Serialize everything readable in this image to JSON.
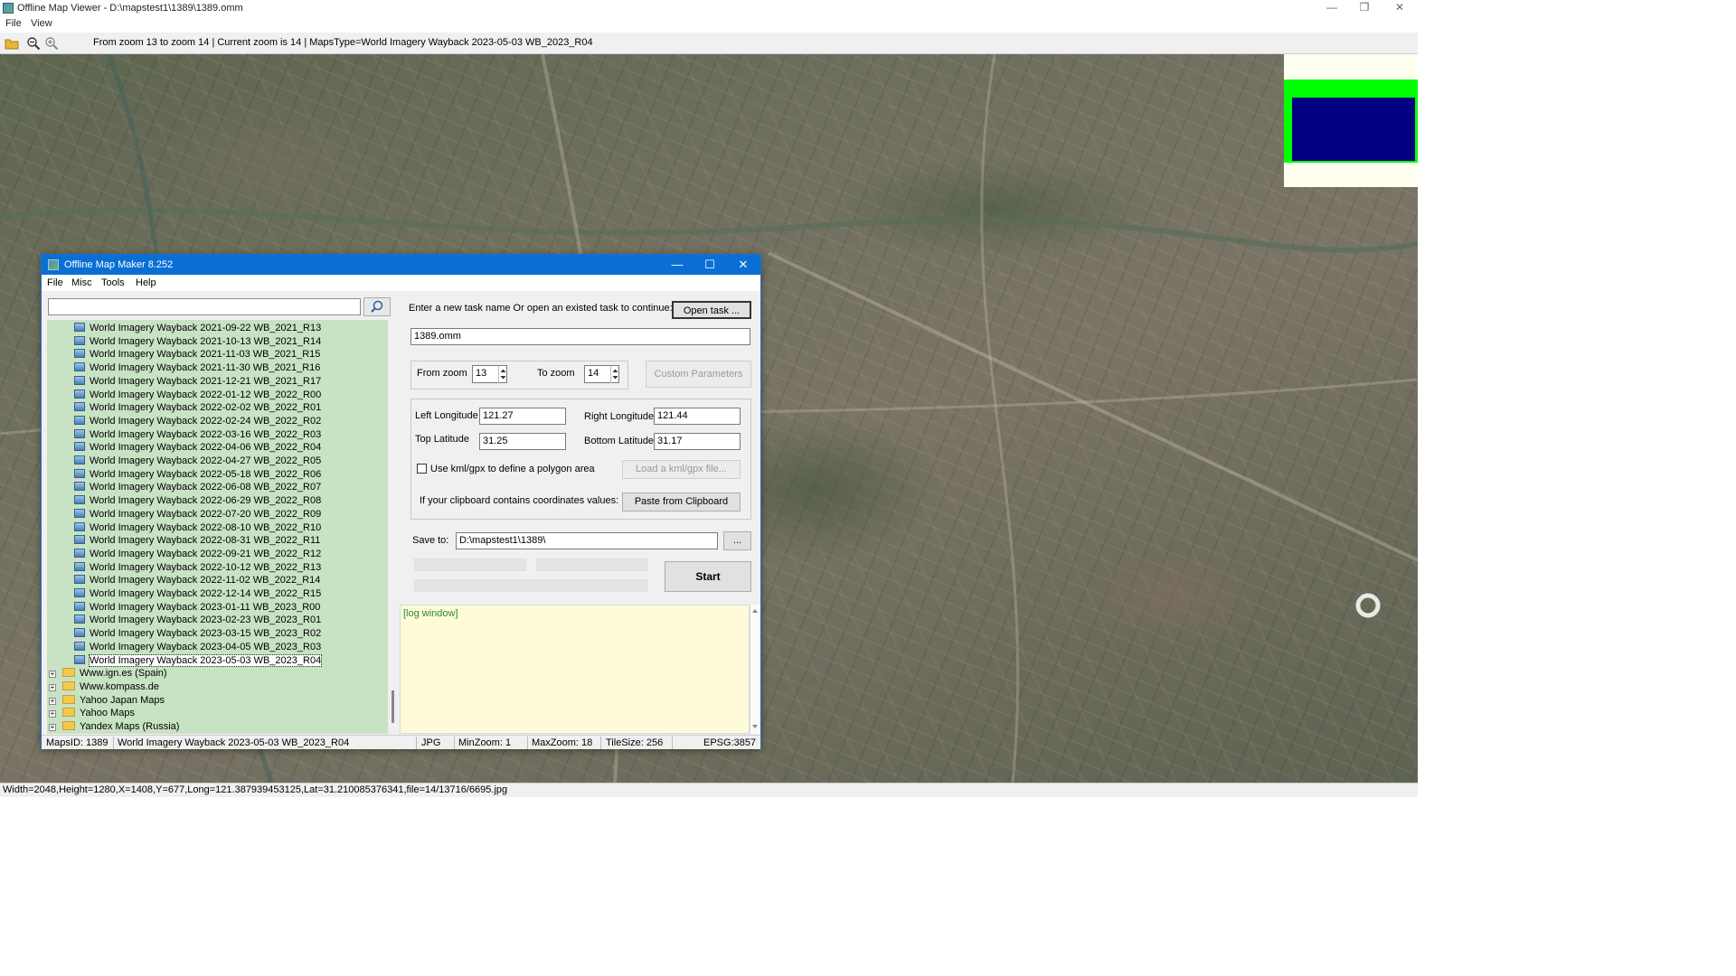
{
  "outer": {
    "title": "Offline Map Viewer - D:\\mapstest1\\1389\\1389.omm",
    "menu": [
      "File",
      "View"
    ],
    "toolbar_status": "From zoom 13 to zoom 14   |   Current zoom is 14  |   MapsType=World Imagery Wayback 2023-05-03 WB_2023_R04",
    "bottom_status": "Width=2048,Height=1280,X=1408,Y=677,Long=121.387939453125,Lat=31.210085376341,file=14/13716/6695.jpg",
    "window_controls": [
      "—",
      "❐",
      "✕"
    ],
    "minimap_colors": {
      "background": "#fffff0",
      "band": "#00ff00",
      "viewport": "#000080"
    }
  },
  "dialog": {
    "title": "Offline Map Maker 8.252",
    "menu": [
      "File",
      "Misc",
      "Tools",
      "Help"
    ],
    "search_value": "",
    "tree_items": [
      "World Imagery Wayback 2021-09-22 WB_2021_R13",
      "World Imagery Wayback 2021-10-13 WB_2021_R14",
      "World Imagery Wayback 2021-11-03 WB_2021_R15",
      "World Imagery Wayback 2021-11-30 WB_2021_R16",
      "World Imagery Wayback 2021-12-21 WB_2021_R17",
      "World Imagery Wayback 2022-01-12 WB_2022_R00",
      "World Imagery Wayback 2022-02-02 WB_2022_R01",
      "World Imagery Wayback 2022-02-24 WB_2022_R02",
      "World Imagery Wayback 2022-03-16 WB_2022_R03",
      "World Imagery Wayback 2022-04-06 WB_2022_R04",
      "World Imagery Wayback 2022-04-27 WB_2022_R05",
      "World Imagery Wayback 2022-05-18 WB_2022_R06",
      "World Imagery Wayback 2022-06-08 WB_2022_R07",
      "World Imagery Wayback 2022-06-29 WB_2022_R08",
      "World Imagery Wayback 2022-07-20 WB_2022_R09",
      "World Imagery Wayback 2022-08-10 WB_2022_R10",
      "World Imagery Wayback 2022-08-31 WB_2022_R11",
      "World Imagery Wayback 2022-09-21 WB_2022_R12",
      "World Imagery Wayback 2022-10-12 WB_2022_R13",
      "World Imagery Wayback 2022-11-02 WB_2022_R14",
      "World Imagery Wayback 2022-12-14 WB_2022_R15",
      "World Imagery Wayback 2023-01-11 WB_2023_R00",
      "World Imagery Wayback 2023-02-23 WB_2023_R01",
      "World Imagery Wayback 2023-03-15 WB_2023_R02",
      "World Imagery Wayback 2023-04-05 WB_2023_R03",
      "World Imagery Wayback 2023-05-03 WB_2023_R04"
    ],
    "tree_folders": [
      "Www.ign.es (Spain)",
      "Www.kompass.de",
      "Yahoo Japan Maps",
      "Yahoo Maps",
      "Yandex Maps (Russia)"
    ],
    "task_prompt": "Enter a new task name Or open an existed task to continue:",
    "open_task_label": "Open task ...",
    "task_name": "1389.omm",
    "from_zoom_label": "From zoom",
    "from_zoom": "13",
    "to_zoom_label": "To zoom",
    "to_zoom": "14",
    "custom_params_label": "Custom Parameters",
    "left_lon_label": "Left Longitude",
    "left_lon": "121.27",
    "right_lon_label": "Right Longitude",
    "right_lon": "121.44",
    "top_lat_label": "Top Latitude",
    "top_lat": "31.25",
    "bottom_lat_label": "Bottom Latitude",
    "bottom_lat": "31.17",
    "kml_label": "Use kml/gpx to define a polygon area",
    "load_kml_label": "Load a kml/gpx file...",
    "clipboard_prompt": "If your clipboard contains coordinates values:",
    "paste_label": "Paste from Clipboard",
    "save_to_label": "Save to:",
    "save_path": "D:\\mapstest1\\1389\\",
    "browse_label": "...",
    "start_label": "Start",
    "log_text": "[log window]",
    "status": {
      "maps_id": "MapsID: 1389",
      "map_name": "World Imagery Wayback 2023-05-03 WB_2023_R04",
      "format": "JPG",
      "min_zoom": "MinZoom: 1",
      "max_zoom": "MaxZoom: 18",
      "tile_size": "TileSize: 256",
      "epsg": "EPSG:3857"
    }
  }
}
